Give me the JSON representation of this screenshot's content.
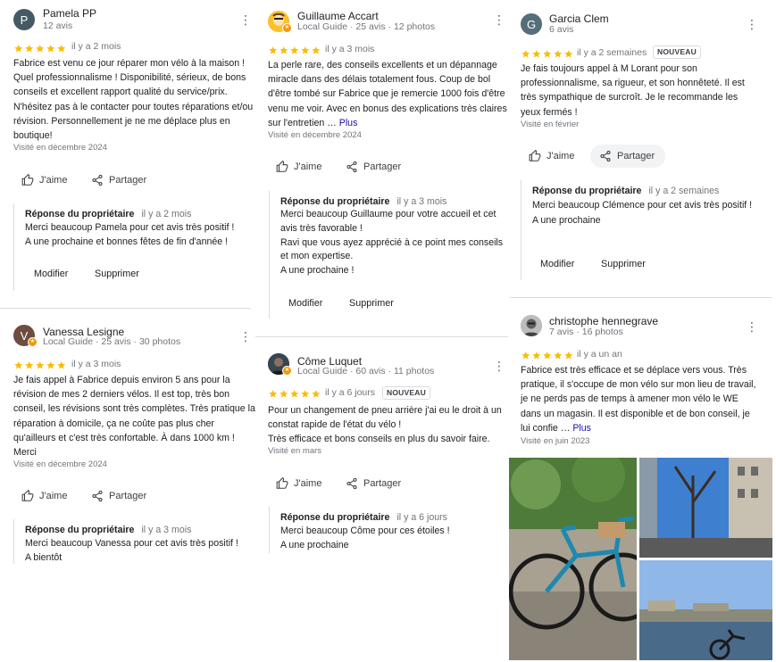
{
  "ui": {
    "like": "J'aime",
    "share": "Partager",
    "modify": "Modifier",
    "delete": "Supprimer",
    "reply_title": "Réponse du propriétaire",
    "more": "Plus",
    "new_badge": "NOUVEAU"
  },
  "colors": {
    "star": "#fbbc04",
    "link": "#1a0dab",
    "muted": "#70757a",
    "badge": "#f29900"
  },
  "reviews": [
    {
      "name": "Pamela PP",
      "initial": "P",
      "meta": "12 avis",
      "date": "il y a 2 mois",
      "text": "Fabrice est venu ce jour réparer mon vélo à la maison ! Quel professionnalisme ! Disponibilité, sérieux, de bons conseils et excellent rapport qualité du service/prix. N'hésitez pas à le contacter pour toutes réparations et/ou révision. Personnellement je ne me déplace plus en boutique!",
      "visit": "Visité en décembre 2024",
      "reply_date": "il y a 2 mois",
      "reply": "Merci beaucoup Pamela pour cet avis très positif !\nA une prochaine et bonnes fêtes de fin d'année !"
    },
    {
      "name": "Vanessa Lesigne",
      "initial": "V",
      "meta": "Local Guide · 25 avis · 30 photos",
      "date": "il y a 3 mois",
      "text": "Je fais appel à Fabrice depuis environ 5 ans pour la révision de mes 2 derniers vélos. Il est top, très bon conseil, les révisions sont très complètes. Très pratique la réparation à domicile, ça ne coûte pas plus cher qu'ailleurs et c'est très confortable. À dans 1000 km ! Merci",
      "visit": "Visité en décembre 2024",
      "reply_date": "il y a 3 mois",
      "reply": "Merci beaucoup Vanessa pour cet avis très positif !\nA bientôt"
    },
    {
      "name": "Guillaume Accart",
      "meta": "Local Guide · 25 avis · 12 photos",
      "date": "il y a 3 mois",
      "text": "La perle rare, des conseils excellents et un dépannage miracle dans des délais totalement fous. Coup de bol d'être tombé sur Fabrice que je remercie 1000 fois d'être venu me voir. Avec en bonus des explications très claires sur l'entretien …",
      "visit": "Visité en décembre 2024",
      "reply_date": "il y a 3 mois",
      "reply": "Merci beaucoup Guillaume pour votre accueil et cet avis très favorable !\nRavi que vous ayez apprécié à ce point mes conseils et mon expertise.\nA une prochaine !"
    },
    {
      "name": "Côme Luquet",
      "meta": "Local Guide · 60 avis · 11 photos",
      "date": "il y a 6 jours",
      "text": "Pour un changement de pneu arrière j'ai eu le droit à un constat rapide de l'état du vélo !\nTrès efficace et bons conseils en plus du savoir faire.",
      "visit": "Visité en mars",
      "reply_date": "il y a 6 jours",
      "reply": "Merci beaucoup Côme pour ces étoiles !\nA une prochaine"
    },
    {
      "name": "Garcia Clem",
      "initial": "G",
      "meta": "6 avis",
      "date": "il y a 2 semaines",
      "text": "Je fais toujours appel à M Lorant pour son professionnalisme, sa rigueur, et son honnêteté. Il est très sympathique de surcroît. Je le recommande les yeux fermés !",
      "visit": "Visité en février",
      "reply_date": "il y a 2 semaines",
      "reply": "Merci beaucoup Clémence pour cet avis très positif !\nA une prochaine"
    },
    {
      "name": "christophe hennegrave",
      "meta": "7 avis · 16 photos",
      "date": "il y a un an",
      "text": "Fabrice est très efficace et se déplace vers vous. Très pratique, il s'occupe de mon vélo sur mon lieu de travail, je ne perds pas de temps à  amener mon vélo le WE dans un magasin. Il est disponible et de bon conseil, je lui confie …",
      "visit": "Visité en juin 2023"
    }
  ]
}
